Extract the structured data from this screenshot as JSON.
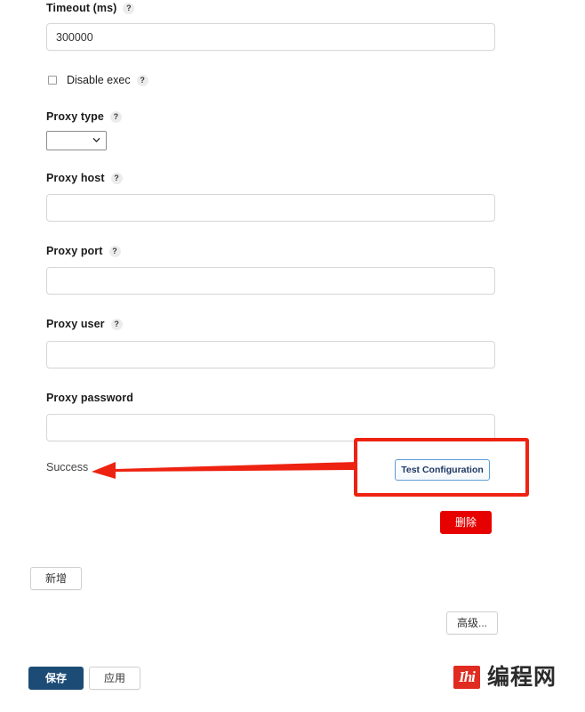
{
  "form": {
    "fields": [
      {
        "name": "timeout",
        "label": "Timeout (ms)",
        "help": "?",
        "value": "300000",
        "placeholder": ""
      },
      {
        "name": "proxy-type",
        "label": "Proxy type",
        "help": "?",
        "value": "",
        "options": [
          ""
        ]
      },
      {
        "name": "proxy-host",
        "label": "Proxy host",
        "help": "?",
        "value": "",
        "placeholder": ""
      },
      {
        "name": "proxy-port",
        "label": "Proxy port",
        "help": "?",
        "value": "",
        "placeholder": ""
      },
      {
        "name": "proxy-user",
        "label": "Proxy user",
        "help": "?",
        "value": "",
        "placeholder": ""
      },
      {
        "name": "proxy-password",
        "label": "Proxy password",
        "help": "",
        "value": "",
        "placeholder": ""
      }
    ],
    "checkbox": {
      "label": "Disable exec",
      "help": "?",
      "checked": false
    },
    "status": "Success"
  },
  "buttons": {
    "test_configuration": "Test Configuration",
    "delete": "删除",
    "add": "新增",
    "advanced": "高级...",
    "save": "保存",
    "apply": "应用"
  },
  "annotation": {
    "color": "#ee2211",
    "arrow": "left-arrow"
  },
  "watermark": {
    "mark": "Ihi",
    "text": "编程网"
  },
  "colors": {
    "accent_blue": "#5a9bd5",
    "save_navy": "#1c4c76",
    "delete_red": "#e60000",
    "annotation_red": "#ee2211"
  }
}
